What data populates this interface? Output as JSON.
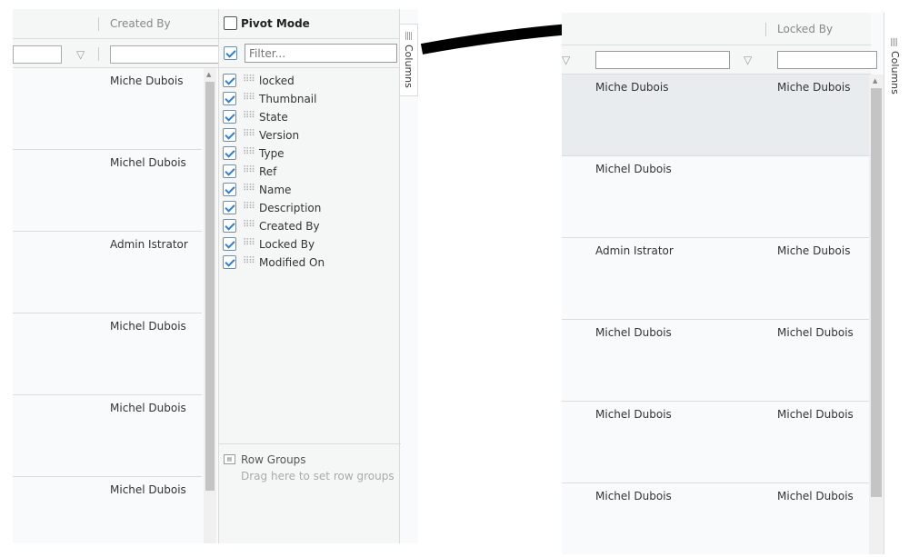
{
  "left_grid": {
    "header": {
      "created_by": "Created By"
    },
    "rows": [
      "Miche Dubois",
      "Michel Dubois",
      "Admin Istrator",
      "Michel Dubois",
      "Michel Dubois",
      "Michel Dubois"
    ]
  },
  "tool_panel": {
    "pivot_mode_label": "Pivot Mode",
    "filter_placeholder": "Filter...",
    "columns": [
      "locked",
      "Thumbnail",
      "State",
      "Version",
      "Type",
      "Ref",
      "Name",
      "Description",
      "Created By",
      "Locked By",
      "Modified On"
    ],
    "row_groups_title": "Row Groups",
    "row_groups_hint": "Drag here to set row groups",
    "side_tab_label": "Columns"
  },
  "right_grid": {
    "header": {
      "locked_by": "Locked By"
    },
    "rows": [
      {
        "created_by": "Miche Dubois",
        "locked_by": "Miche Dubois"
      },
      {
        "created_by": "Michel Dubois",
        "locked_by": ""
      },
      {
        "created_by": "Admin Istrator",
        "locked_by": "Miche Dubois"
      },
      {
        "created_by": "Michel Dubois",
        "locked_by": "Michel Dubois"
      },
      {
        "created_by": "Michel Dubois",
        "locked_by": "Michel Dubois"
      },
      {
        "created_by": "Michel Dubois",
        "locked_by": "Michel Dubois"
      }
    ],
    "side_tab_label": "Columns"
  }
}
